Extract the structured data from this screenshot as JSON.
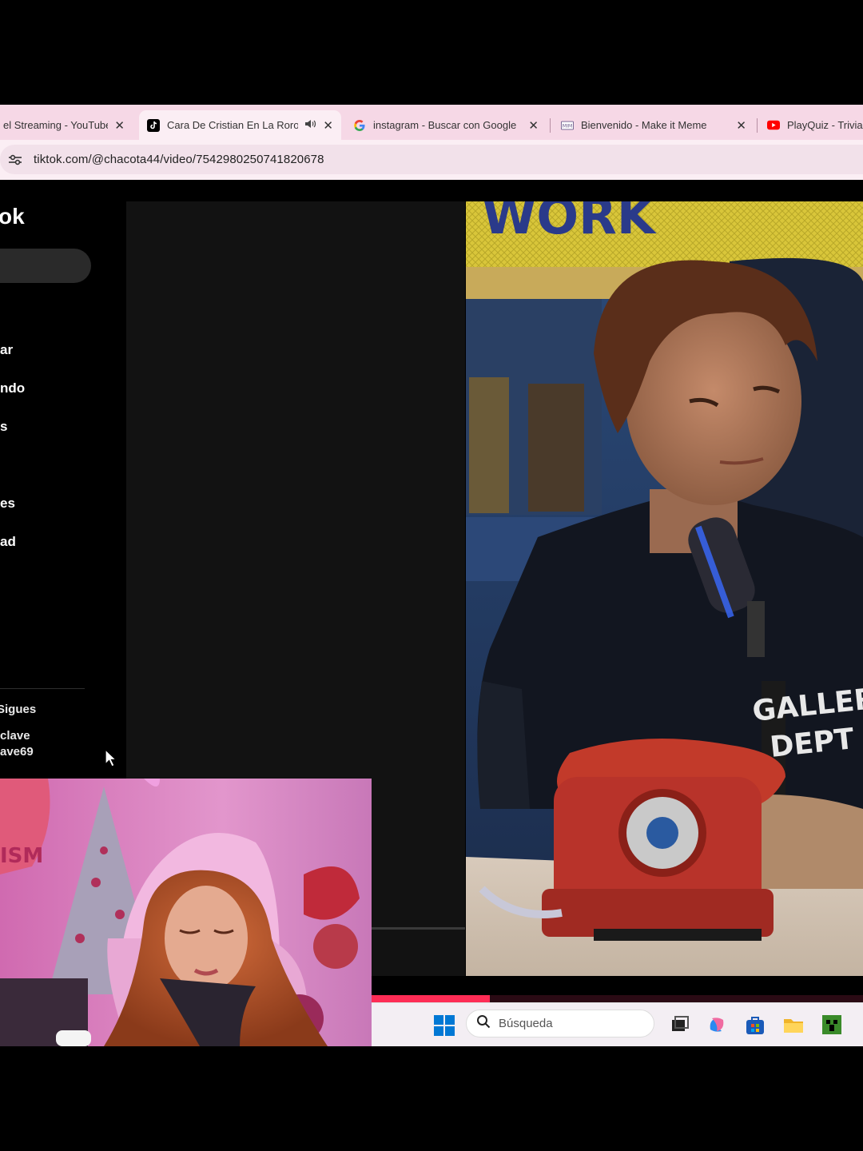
{
  "browser": {
    "tabs": [
      {
        "title": "el Streaming - YouTube",
        "favicon": "youtube-icon",
        "active": false
      },
      {
        "title": "Cara De Cristian En La Roro",
        "favicon": "tiktok-icon",
        "active": true,
        "audio": "speaker-icon"
      },
      {
        "title": "instagram - Buscar con Google",
        "favicon": "google-icon",
        "active": false
      },
      {
        "title": "Bienvenido - Make it Meme",
        "favicon": "meme-icon",
        "active": false
      },
      {
        "title": "PlayQuiz - Trivia",
        "favicon": "youtube-icon",
        "active": false
      }
    ],
    "close_glyph": "✕",
    "url": "tiktok.com/@chacota44/video/7542980250741820678"
  },
  "tiktok": {
    "logo_fragment": "ok",
    "nav": [
      "ar",
      "ndo",
      "s",
      "es",
      "ad"
    ],
    "footer": [
      "Sigues",
      "clave",
      "ave69"
    ],
    "progress": 0.24,
    "accent": "#fe2c55"
  },
  "video": {
    "sign_text": "WORK",
    "shirt_text_1": "GALLERY",
    "shirt_text_2": "DEPT"
  },
  "taskbar": {
    "search_placeholder": "Búsqueda",
    "icons": [
      "windows-start-icon",
      "search-icon",
      "task-view-icon",
      "copilot-icon",
      "store-icon",
      "file-explorer-icon",
      "minecraft-icon"
    ]
  }
}
